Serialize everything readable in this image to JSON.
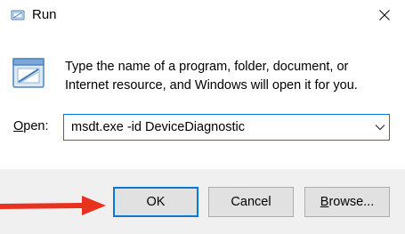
{
  "window": {
    "title": "Run"
  },
  "dialog": {
    "description": "Type the name of a program, folder, document, or Internet resource, and Windows will open it for you.",
    "open_label_mnemonic": "O",
    "open_label_rest": "pen:",
    "open_value": "msdt.exe -id DeviceDiagnostic"
  },
  "buttons": {
    "ok": "OK",
    "cancel": "Cancel",
    "browse_mnemonic": "B",
    "browse_rest": "rowse..."
  },
  "annotation": {
    "arrow_color": "#e8321e",
    "arrow_target": "ok-button"
  },
  "colors": {
    "accent": "#0078d7",
    "footer_bg": "#f0f0f0",
    "button_bg": "#e1e1e1"
  },
  "icons": [
    "run-app-icon",
    "close-icon",
    "run-program-icon",
    "chevron-down-icon",
    "pointer-arrow-icon"
  ]
}
